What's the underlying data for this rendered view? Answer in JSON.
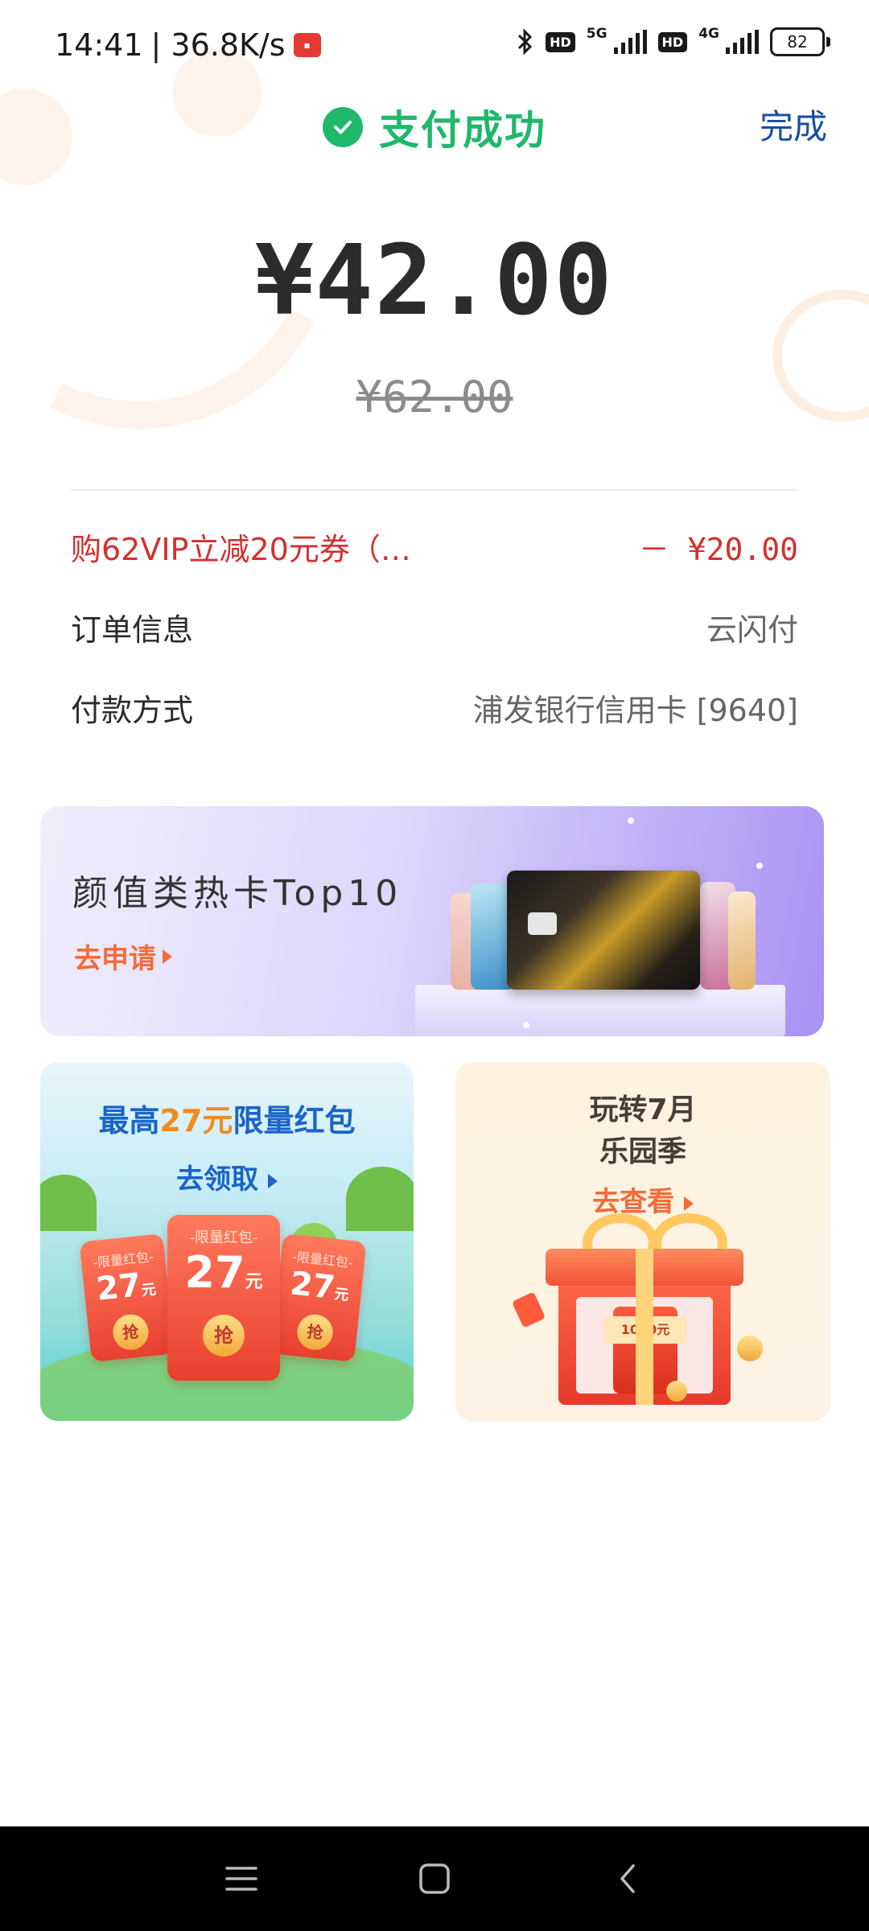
{
  "status_bar": {
    "time": "14:41",
    "speed": "| 36.8K/s",
    "hd1": "HD",
    "net1": "5G",
    "hd2": "HD",
    "net2": "4G",
    "battery": "82"
  },
  "header": {
    "title": "支付成功",
    "done_label": "完成"
  },
  "payment": {
    "amount": "¥42.00",
    "original_amount": "¥62.00"
  },
  "details": [
    {
      "label": "购62VIP立减20元券（…",
      "value": "－ ¥20.00"
    },
    {
      "label": "订单信息",
      "value": "云闪付"
    },
    {
      "label": "付款方式",
      "value": "浦发银行信用卡 [9640]"
    }
  ],
  "banner": {
    "title": "颜值类热卡Top10",
    "cta": "去申请"
  },
  "promo_left": {
    "title_prefix": "最高",
    "title_amount": "27元",
    "title_suffix": "限量红包",
    "cta": "去领取",
    "envelope_caption": "-限量红包-",
    "envelope_amount": "27",
    "envelope_unit": "元",
    "envelope_button": "抢"
  },
  "promo_right": {
    "title_line1": "玩转7月",
    "title_line2": "乐园季",
    "cta": "去查看",
    "voucher_label": "1000元"
  },
  "colors": {
    "success_green": "#1fb86b",
    "discount_red": "#d3302f",
    "link_blue": "#1a4fa0",
    "cta_orange": "#f26b3a"
  }
}
